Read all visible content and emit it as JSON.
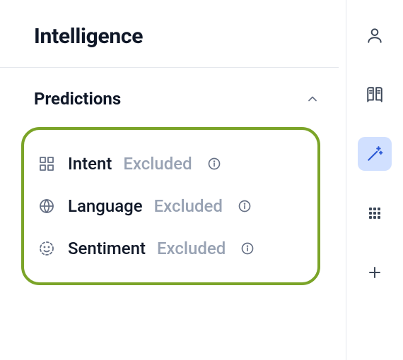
{
  "panel": {
    "title": "Intelligence"
  },
  "sections": {
    "predictions": {
      "title": "Predictions",
      "expanded": true,
      "items": [
        {
          "icon": "squares-icon",
          "label": "Intent",
          "status": "Excluded"
        },
        {
          "icon": "globe-icon",
          "label": "Language",
          "status": "Excluded"
        },
        {
          "icon": "sentiment-icon",
          "label": "Sentiment",
          "status": "Excluded"
        }
      ]
    }
  },
  "rail": {
    "items": [
      {
        "icon": "user-icon",
        "active": false
      },
      {
        "icon": "book-icon",
        "active": false
      },
      {
        "icon": "wand-icon",
        "active": true
      },
      {
        "icon": "grid-icon",
        "active": false
      },
      {
        "icon": "plus-icon",
        "active": false
      }
    ]
  }
}
